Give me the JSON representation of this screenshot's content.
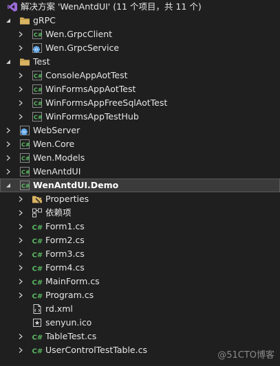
{
  "solution": {
    "label": "解决方案 'WenAntdUI' (11 个项目，共 11 个)"
  },
  "nodes": {
    "grpc": "gRPC",
    "grpc_client": "Wen.GrpcClient",
    "grpc_service": "Wen.GrpcService",
    "test": "Test",
    "console_aot": "ConsoleAppAotTest",
    "winforms_aot": "WinFormsAppAotTest",
    "winforms_freesql": "WinFormsAppFreeSqlAotTest",
    "winforms_hub": "WinFormsAppTestHub",
    "webserver": "WebServer",
    "core": "Wen.Core",
    "models": "Wen.Models",
    "antdui": "WenAntdUI",
    "demo": "WenAntdUI.Demo",
    "properties": "Properties",
    "dependencies": "依赖项",
    "form1": "Form1.cs",
    "form2": "Form2.cs",
    "form3": "Form3.cs",
    "form4": "Form4.cs",
    "mainform": "MainForm.cs",
    "program": "Program.cs",
    "rdxml": "rd.xml",
    "senyun": "senyun.ico",
    "tabletest": "TableTest.cs",
    "usercontrol": "UserControlTestTable.cs"
  },
  "icons": {
    "csharp_project": "csharp-project-icon",
    "folder": "folder-icon",
    "web_project": "web-project-icon",
    "csharp_file": "csharp-file-icon"
  },
  "colors": {
    "background": "#1f1f1f",
    "text": "#e6e6e6",
    "selection": "#3b3b3b",
    "csharp_green": "#5ab962",
    "folder": "#d9b463",
    "vs_purple": "#9b6bd8"
  },
  "watermark": "@51CTO博客"
}
